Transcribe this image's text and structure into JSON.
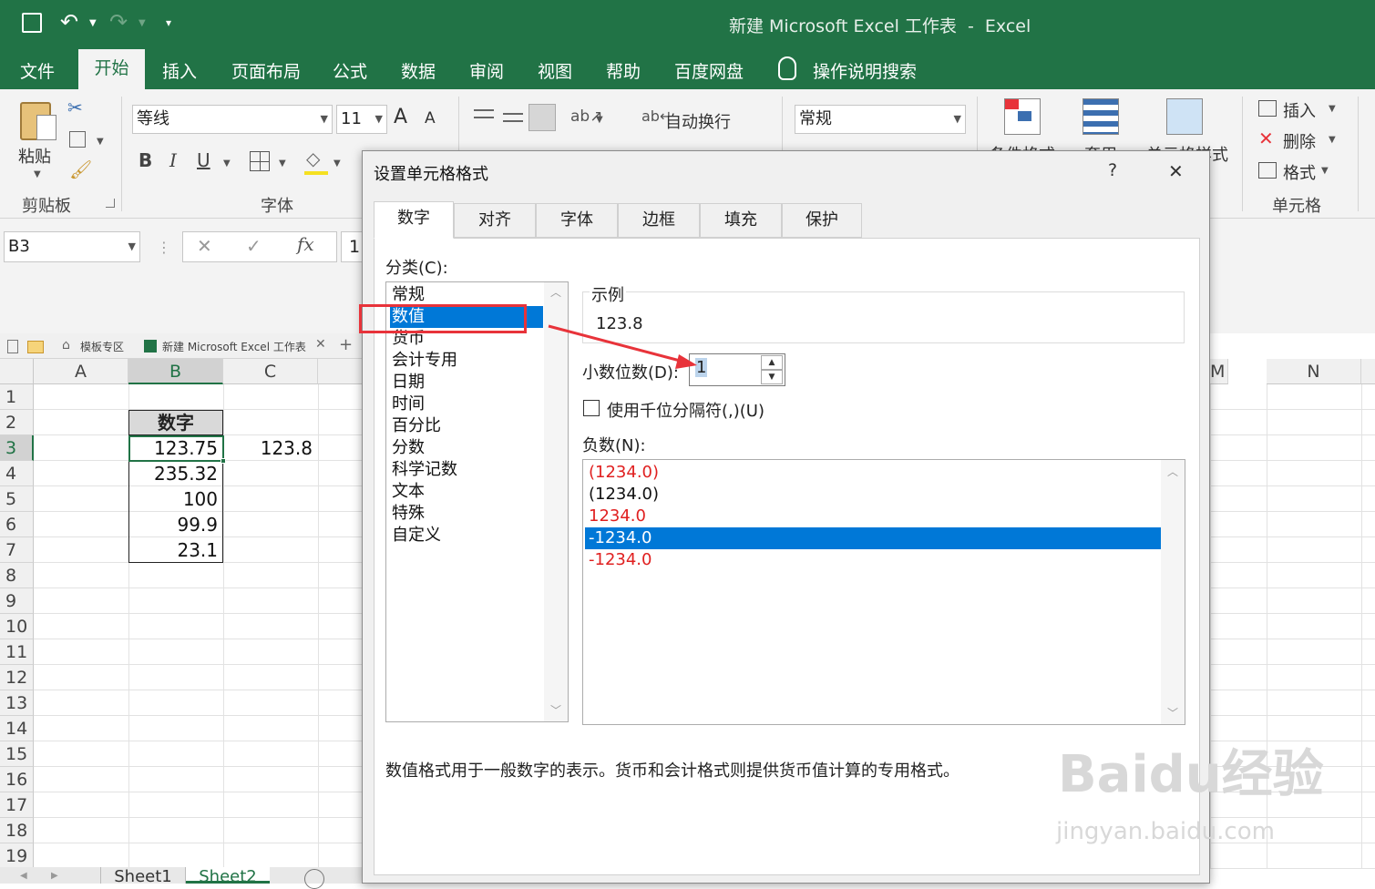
{
  "window": {
    "title": "新建 Microsoft Excel 工作表  -  Excel"
  },
  "menu": {
    "items": [
      "文件",
      "开始",
      "插入",
      "页面布局",
      "公式",
      "数据",
      "审阅",
      "视图",
      "帮助",
      "百度网盘"
    ],
    "search": "操作说明搜索"
  },
  "ribbon": {
    "clipboard_label": "剪贴板",
    "paste_label": "粘贴",
    "font_name": "等线",
    "font_size": "11",
    "font_label": "字体",
    "wrap_text": "自动换行",
    "number_format": "常规",
    "conditional_format": "条件格式",
    "table_format": "套用",
    "cell_styles": "单元格样式",
    "insert": "插入",
    "delete": "删除",
    "format": "格式",
    "cells_label": "单元格",
    "font_glyphs": {
      "bold": "B",
      "italic": "I",
      "underline": "U",
      "grow": "A",
      "shrink": "A"
    }
  },
  "formula_bar": {
    "name_box": "B3",
    "fx": "fx",
    "value": "1"
  },
  "file_tabs": {
    "template": "模板专区",
    "workbook": "新建 Microsoft Excel 工作表"
  },
  "grid": {
    "columns": [
      "A",
      "B",
      "C",
      "M",
      "N"
    ],
    "rows": [
      "1",
      "2",
      "3",
      "4",
      "5",
      "6",
      "7",
      "8",
      "9",
      "10",
      "11",
      "12",
      "13",
      "14",
      "15",
      "16",
      "17",
      "18",
      "19"
    ],
    "header_cell": "数字",
    "b_values": [
      "123.75",
      "235.32",
      "100",
      "99.9",
      "23.1"
    ],
    "c3": "123.8"
  },
  "sheet_tabs": [
    "Sheet1",
    "Sheet2"
  ],
  "dialog": {
    "title": "设置单元格格式",
    "help": "?",
    "close": "✕",
    "tabs": [
      "数字",
      "对齐",
      "字体",
      "边框",
      "填充",
      "保护"
    ],
    "category_label": "分类(C):",
    "categories": [
      "常规",
      "数值",
      "货币",
      "会计专用",
      "日期",
      "时间",
      "百分比",
      "分数",
      "科学记数",
      "文本",
      "特殊",
      "自定义"
    ],
    "selected_category": "数值",
    "sample_label": "示例",
    "sample_value": "123.8",
    "decimal_label": "小数位数(D):",
    "decimal_value": "1",
    "thousands_label": "使用千位分隔符(,)(U)",
    "negative_label": "负数(N):",
    "negatives": [
      "(1234.0)",
      "(1234.0)",
      "1234.0",
      "-1234.0",
      "-1234.0"
    ],
    "negative_colors": [
      "#e02020",
      "#111111",
      "#e02020",
      "#ffffff",
      "#e02020"
    ],
    "selected_negative": "-1234.0",
    "description": "数值格式用于一般数字的表示。货币和会计格式则提供货币值计算的专用格式。"
  },
  "watermark": {
    "brand": "Baidu经验",
    "url": "jingyan.baidu.com"
  },
  "colors": {
    "excel_green": "#217346",
    "selection_blue": "#0078d7",
    "annotation_red": "#e8333a"
  }
}
